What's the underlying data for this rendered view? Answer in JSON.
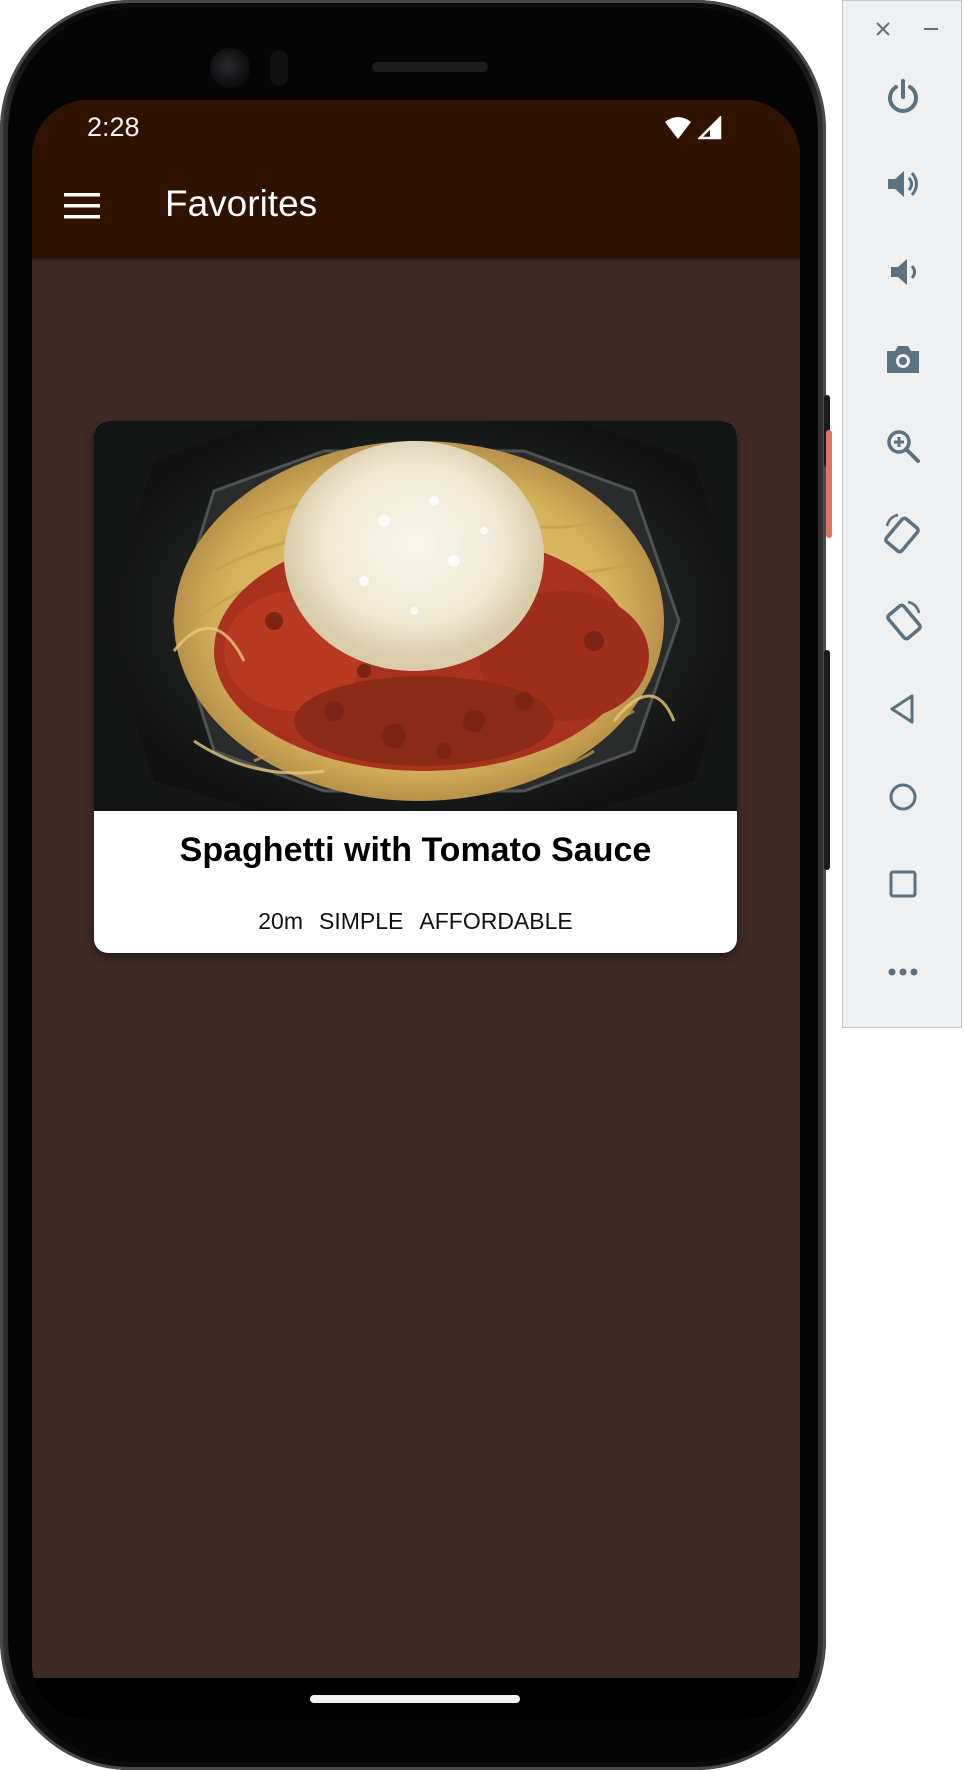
{
  "status_bar": {
    "time": "2:28",
    "icons": [
      "wifi-icon",
      "signal-icon"
    ]
  },
  "app_bar": {
    "title": "Favorites",
    "menu_icon": "hamburger-menu-icon"
  },
  "favorites": [
    {
      "title": "Spaghetti with Tomato Sauce",
      "duration": "20m",
      "complexity": "SIMPLE",
      "affordability": "AFFORDABLE",
      "image": "spaghetti-image"
    }
  ],
  "emulator_panel": {
    "window_controls": [
      "close-icon",
      "minimize-icon"
    ],
    "buttons": [
      "power-icon",
      "volume-up-icon",
      "volume-down-icon",
      "camera-icon",
      "zoom-icon",
      "rotate-left-icon",
      "rotate-right-icon",
      "back-icon",
      "home-icon",
      "overview-icon",
      "more-icon"
    ]
  },
  "colors": {
    "app_bar": "#301200",
    "background": "#3e2c23",
    "card": "#ffffff",
    "emulator_icon": "#5b7282"
  }
}
